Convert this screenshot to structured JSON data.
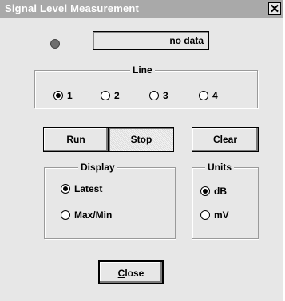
{
  "window": {
    "title": "Signal Level Measurement"
  },
  "status": {
    "text": "no data"
  },
  "line_group": {
    "legend": "Line",
    "options": [
      {
        "label": "1",
        "checked": true
      },
      {
        "label": "2",
        "checked": false
      },
      {
        "label": "3",
        "checked": false
      },
      {
        "label": "4",
        "checked": false
      }
    ]
  },
  "buttons": {
    "run": "Run",
    "stop": "Stop",
    "clear": "Clear",
    "close": "Close"
  },
  "display_group": {
    "legend": "Display",
    "options": [
      {
        "label": "Latest",
        "checked": true
      },
      {
        "label": "Max/Min",
        "checked": false
      }
    ]
  },
  "units_group": {
    "legend": "Units",
    "options": [
      {
        "label": "dB",
        "checked": true
      },
      {
        "label": "mV",
        "checked": false
      }
    ]
  },
  "icons": {
    "close": "close-icon",
    "indicator": "status-led-icon"
  }
}
